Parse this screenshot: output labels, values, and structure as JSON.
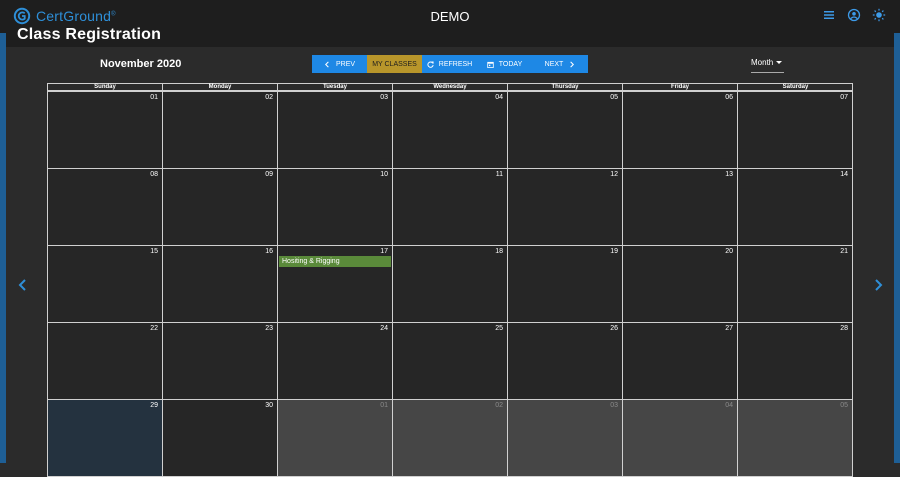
{
  "header": {
    "brand": "CertGround",
    "brand_mark": "®",
    "title": "DEMO",
    "icons": [
      "menu-icon",
      "account-icon",
      "brightness-icon"
    ]
  },
  "page": {
    "heading": "Class Registration"
  },
  "calendar": {
    "month_label": "November 2020",
    "toolbar": {
      "prev": "PREV",
      "my_classes": "MY CLASSES",
      "refresh": "REFRESH",
      "today": "TODAY",
      "next": "NEXT"
    },
    "view": "Month",
    "weekdays": [
      "Sunday",
      "Monday",
      "Tuesday",
      "Wednesday",
      "Thursday",
      "Friday",
      "Saturday"
    ],
    "weeks": [
      [
        {
          "d": "01"
        },
        {
          "d": "02"
        },
        {
          "d": "03"
        },
        {
          "d": "04"
        },
        {
          "d": "05"
        },
        {
          "d": "06"
        },
        {
          "d": "07"
        }
      ],
      [
        {
          "d": "08"
        },
        {
          "d": "09"
        },
        {
          "d": "10"
        },
        {
          "d": "11"
        },
        {
          "d": "12"
        },
        {
          "d": "13"
        },
        {
          "d": "14"
        }
      ],
      [
        {
          "d": "15"
        },
        {
          "d": "16"
        },
        {
          "d": "17",
          "event": "Hositing & Rigging"
        },
        {
          "d": "18"
        },
        {
          "d": "19"
        },
        {
          "d": "20"
        },
        {
          "d": "21"
        }
      ],
      [
        {
          "d": "22"
        },
        {
          "d": "23"
        },
        {
          "d": "24"
        },
        {
          "d": "25"
        },
        {
          "d": "26"
        },
        {
          "d": "27"
        },
        {
          "d": "28"
        }
      ],
      [
        {
          "d": "29",
          "today": true
        },
        {
          "d": "30"
        },
        {
          "d": "01",
          "other": true
        },
        {
          "d": "02",
          "other": true
        },
        {
          "d": "03",
          "other": true
        },
        {
          "d": "04",
          "other": true
        },
        {
          "d": "05",
          "other": true
        }
      ]
    ],
    "colors": {
      "accent": "#1e88e5",
      "active_button": "#b8962b",
      "event": "#5a8a3a",
      "today": "#24323f"
    }
  }
}
